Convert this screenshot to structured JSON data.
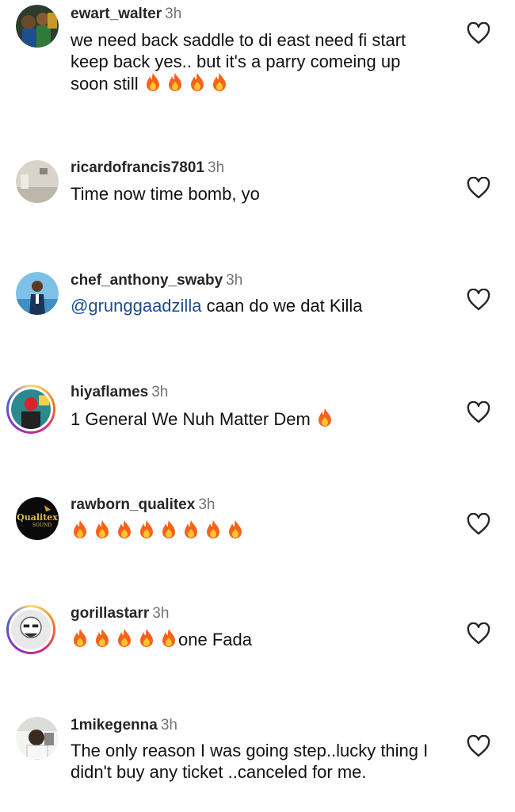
{
  "comments": [
    {
      "username": "ewart_walter",
      "time": "3h",
      "text": "we need back saddle to di east need fi start keep back yes.. but it's a parry comeing up soon still",
      "fire_after": 4,
      "avatar": "avatar-cartoon"
    },
    {
      "username": "ricardofrancis7801",
      "time": "3h",
      "text": "Time now time bomb, yo",
      "fire_after": 0,
      "avatar": "avatar-room"
    },
    {
      "username": "chef_anthony_swaby",
      "time": "3h",
      "mention": "@grunggaadzilla",
      "text": " caan do we dat Killa",
      "fire_after": 0,
      "avatar": "avatar-man-suit"
    },
    {
      "username": "hiyaflames",
      "time": "3h",
      "text": "1 General We Nuh Matter Dem",
      "fire_after": 1,
      "avatar": "avatar-story-ring"
    },
    {
      "username": "rawborn_qualitex",
      "time": "3h",
      "text": "",
      "fire_before": 8,
      "avatar": "avatar-qualitex",
      "avatar_text": "Qualitex",
      "avatar_sub": "SOUND"
    },
    {
      "username": "gorillastarr",
      "time": "3h",
      "text": "one Fada",
      "fire_before": 5,
      "avatar": "avatar-story-ring"
    },
    {
      "username": "1mikegenna",
      "time": "3h",
      "text": "The only reason I was going step..lucky thing I didn't buy any ticket ..canceled for me.",
      "fire_after": 0,
      "avatar": "avatar-selfie"
    }
  ],
  "icons": {
    "like": "heart-outline-icon",
    "fire": "fire-emoji-icon"
  },
  "colors": {
    "mention": "#1f4e8c",
    "time": "#737373",
    "heart": "#262626"
  }
}
